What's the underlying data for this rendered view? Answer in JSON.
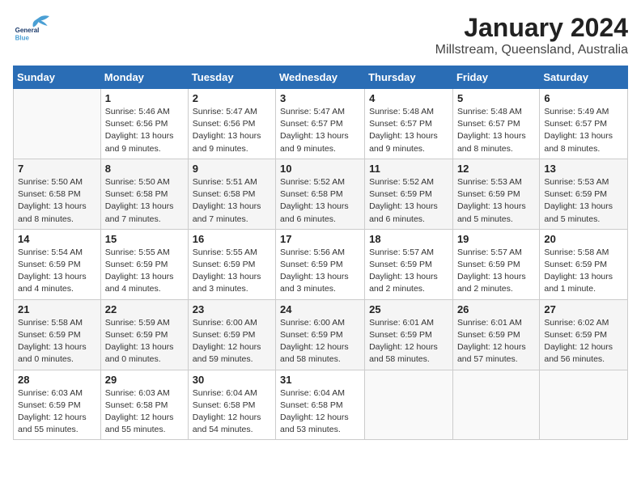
{
  "header": {
    "logo_line1": "General",
    "logo_line2": "Blue",
    "title": "January 2024",
    "subtitle": "Millstream, Queensland, Australia"
  },
  "days_of_week": [
    "Sunday",
    "Monday",
    "Tuesday",
    "Wednesday",
    "Thursday",
    "Friday",
    "Saturday"
  ],
  "weeks": [
    [
      {
        "day": "",
        "info": ""
      },
      {
        "day": "1",
        "info": "Sunrise: 5:46 AM\nSunset: 6:56 PM\nDaylight: 13 hours\nand 9 minutes."
      },
      {
        "day": "2",
        "info": "Sunrise: 5:47 AM\nSunset: 6:56 PM\nDaylight: 13 hours\nand 9 minutes."
      },
      {
        "day": "3",
        "info": "Sunrise: 5:47 AM\nSunset: 6:57 PM\nDaylight: 13 hours\nand 9 minutes."
      },
      {
        "day": "4",
        "info": "Sunrise: 5:48 AM\nSunset: 6:57 PM\nDaylight: 13 hours\nand 9 minutes."
      },
      {
        "day": "5",
        "info": "Sunrise: 5:48 AM\nSunset: 6:57 PM\nDaylight: 13 hours\nand 8 minutes."
      },
      {
        "day": "6",
        "info": "Sunrise: 5:49 AM\nSunset: 6:57 PM\nDaylight: 13 hours\nand 8 minutes."
      }
    ],
    [
      {
        "day": "7",
        "info": "Sunrise: 5:50 AM\nSunset: 6:58 PM\nDaylight: 13 hours\nand 8 minutes."
      },
      {
        "day": "8",
        "info": "Sunrise: 5:50 AM\nSunset: 6:58 PM\nDaylight: 13 hours\nand 7 minutes."
      },
      {
        "day": "9",
        "info": "Sunrise: 5:51 AM\nSunset: 6:58 PM\nDaylight: 13 hours\nand 7 minutes."
      },
      {
        "day": "10",
        "info": "Sunrise: 5:52 AM\nSunset: 6:58 PM\nDaylight: 13 hours\nand 6 minutes."
      },
      {
        "day": "11",
        "info": "Sunrise: 5:52 AM\nSunset: 6:59 PM\nDaylight: 13 hours\nand 6 minutes."
      },
      {
        "day": "12",
        "info": "Sunrise: 5:53 AM\nSunset: 6:59 PM\nDaylight: 13 hours\nand 5 minutes."
      },
      {
        "day": "13",
        "info": "Sunrise: 5:53 AM\nSunset: 6:59 PM\nDaylight: 13 hours\nand 5 minutes."
      }
    ],
    [
      {
        "day": "14",
        "info": "Sunrise: 5:54 AM\nSunset: 6:59 PM\nDaylight: 13 hours\nand 4 minutes."
      },
      {
        "day": "15",
        "info": "Sunrise: 5:55 AM\nSunset: 6:59 PM\nDaylight: 13 hours\nand 4 minutes."
      },
      {
        "day": "16",
        "info": "Sunrise: 5:55 AM\nSunset: 6:59 PM\nDaylight: 13 hours\nand 3 minutes."
      },
      {
        "day": "17",
        "info": "Sunrise: 5:56 AM\nSunset: 6:59 PM\nDaylight: 13 hours\nand 3 minutes."
      },
      {
        "day": "18",
        "info": "Sunrise: 5:57 AM\nSunset: 6:59 PM\nDaylight: 13 hours\nand 2 minutes."
      },
      {
        "day": "19",
        "info": "Sunrise: 5:57 AM\nSunset: 6:59 PM\nDaylight: 13 hours\nand 2 minutes."
      },
      {
        "day": "20",
        "info": "Sunrise: 5:58 AM\nSunset: 6:59 PM\nDaylight: 13 hours\nand 1 minute."
      }
    ],
    [
      {
        "day": "21",
        "info": "Sunrise: 5:58 AM\nSunset: 6:59 PM\nDaylight: 13 hours\nand 0 minutes."
      },
      {
        "day": "22",
        "info": "Sunrise: 5:59 AM\nSunset: 6:59 PM\nDaylight: 13 hours\nand 0 minutes."
      },
      {
        "day": "23",
        "info": "Sunrise: 6:00 AM\nSunset: 6:59 PM\nDaylight: 12 hours\nand 59 minutes."
      },
      {
        "day": "24",
        "info": "Sunrise: 6:00 AM\nSunset: 6:59 PM\nDaylight: 12 hours\nand 58 minutes."
      },
      {
        "day": "25",
        "info": "Sunrise: 6:01 AM\nSunset: 6:59 PM\nDaylight: 12 hours\nand 58 minutes."
      },
      {
        "day": "26",
        "info": "Sunrise: 6:01 AM\nSunset: 6:59 PM\nDaylight: 12 hours\nand 57 minutes."
      },
      {
        "day": "27",
        "info": "Sunrise: 6:02 AM\nSunset: 6:59 PM\nDaylight: 12 hours\nand 56 minutes."
      }
    ],
    [
      {
        "day": "28",
        "info": "Sunrise: 6:03 AM\nSunset: 6:59 PM\nDaylight: 12 hours\nand 55 minutes."
      },
      {
        "day": "29",
        "info": "Sunrise: 6:03 AM\nSunset: 6:58 PM\nDaylight: 12 hours\nand 55 minutes."
      },
      {
        "day": "30",
        "info": "Sunrise: 6:04 AM\nSunset: 6:58 PM\nDaylight: 12 hours\nand 54 minutes."
      },
      {
        "day": "31",
        "info": "Sunrise: 6:04 AM\nSunset: 6:58 PM\nDaylight: 12 hours\nand 53 minutes."
      },
      {
        "day": "",
        "info": ""
      },
      {
        "day": "",
        "info": ""
      },
      {
        "day": "",
        "info": ""
      }
    ]
  ]
}
